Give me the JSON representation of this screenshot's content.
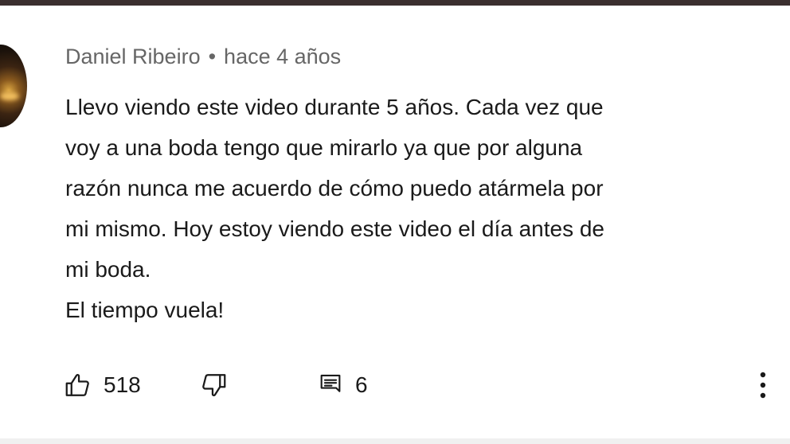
{
  "comment": {
    "author": "Daniel Ribeiro",
    "separator": "•",
    "time": "hace 4 años",
    "lines": [
      "Llevo viendo este video durante 5 años. Cada vez que",
      "voy a una boda tengo que mirarlo ya que por alguna",
      "razón nunca me acuerdo de cómo puedo atármela por",
      "mi mismo. Hoy estoy viendo este video el día antes de",
      "mi boda.",
      "El tiempo vuela!"
    ],
    "likes": "518",
    "replies": "6"
  },
  "icons": {
    "like": "thumbs-up-icon",
    "dislike": "thumbs-down-icon",
    "reply": "reply-comment-icon",
    "more": "more-vertical-icon"
  }
}
